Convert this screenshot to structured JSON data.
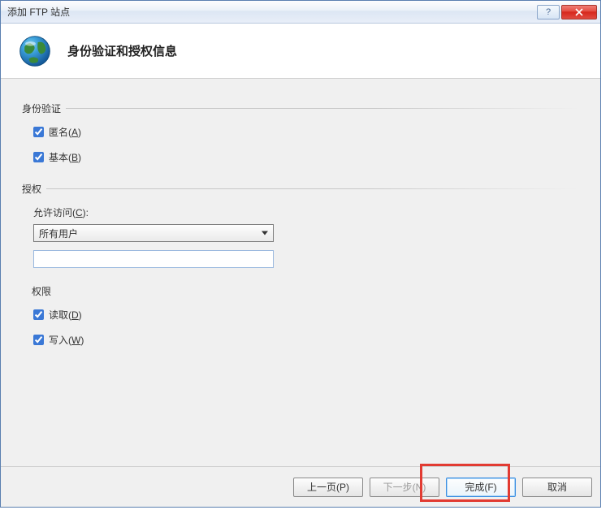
{
  "window": {
    "title": "添加 FTP 站点"
  },
  "header": {
    "title": "身份验证和授权信息"
  },
  "auth": {
    "legend": "身份验证",
    "anonymous_label": "匿名(A)",
    "anonymous_prefix": "匿名(",
    "anonymous_hotkey": "A",
    "anonymous_suffix": ")",
    "basic_label": "基本(B)",
    "basic_prefix": "基本(",
    "basic_hotkey": "B",
    "basic_suffix": ")"
  },
  "authz": {
    "legend": "授权",
    "allow_access_label": "允许访问(C):",
    "allow_access_prefix": "允许访问(",
    "allow_access_hotkey": "C",
    "allow_access_suffix": "):",
    "selected_option": "所有用户",
    "input_value": "",
    "perm_label": "权限",
    "read_prefix": "读取(",
    "read_hotkey": "D",
    "read_suffix": ")",
    "write_prefix": "写入(",
    "write_hotkey": "W",
    "write_suffix": ")"
  },
  "footer": {
    "prev_label": "上一页(P)",
    "next_label": "下一步(N)",
    "finish_label": "完成(F)",
    "cancel_label": "取消"
  }
}
